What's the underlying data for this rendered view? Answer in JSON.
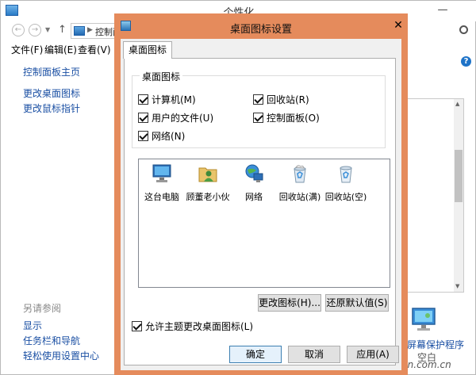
{
  "window": {
    "title": "个性化",
    "minimize_glyph": "—",
    "address": "控制面",
    "menu": [
      "文件(F)",
      "编辑(E)",
      "查看(V)"
    ],
    "sidebar_links": [
      "控制面板主页",
      "更改桌面图标",
      "更改鼠标指针"
    ],
    "see_also": {
      "heading": "另请参阅",
      "links": [
        "显示",
        "任务栏和导航",
        "轻松使用设置中心"
      ]
    },
    "screensaver": {
      "label": "屏幕保护程序",
      "status": "空白"
    },
    "help_glyph": "?"
  },
  "watermark": "www.cfan.com.cn",
  "dialog": {
    "title": "桌面图标设置",
    "close_glyph": "✕",
    "tab": "桌面图标",
    "group_title": "桌面图标",
    "checkboxes": [
      {
        "label": "计算机(M)",
        "checked": true
      },
      {
        "label": "回收站(R)",
        "checked": true
      },
      {
        "label": "用户的文件(U)",
        "checked": true
      },
      {
        "label": "控制面板(O)",
        "checked": true
      },
      {
        "label": "网络(N)",
        "checked": true
      }
    ],
    "icons": [
      {
        "label": "这台电脑",
        "icon": "computer-icon"
      },
      {
        "label": "顾董老小伙",
        "icon": "user-folder-icon"
      },
      {
        "label": "网络",
        "icon": "network-icon"
      },
      {
        "label": "回收站(满)",
        "icon": "recycle-bin-full-icon"
      },
      {
        "label": "回收站(空)",
        "icon": "recycle-bin-empty-icon"
      }
    ],
    "change_icon_button": "更改图标(H)...",
    "restore_default_button": "还原默认值(S)",
    "allow_themes": {
      "label": "允许主题更改桌面图标(L)",
      "checked": true
    },
    "ok_button": "确定",
    "cancel_button": "取消",
    "apply_button": "应用(A)"
  },
  "colors": {
    "dialog_frame": "#e58b5c",
    "link": "#1a4fa3",
    "primary_border": "#3c7fb1"
  }
}
